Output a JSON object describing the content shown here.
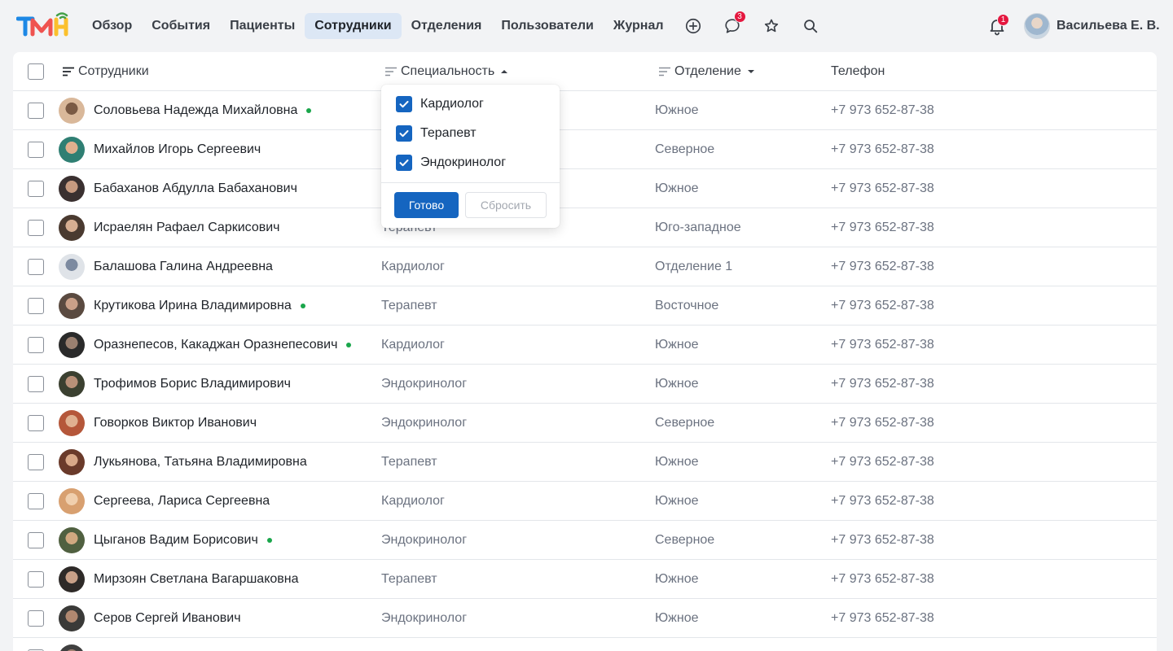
{
  "nav": {
    "items": [
      {
        "label": "Обзор",
        "active": false
      },
      {
        "label": "События",
        "active": false
      },
      {
        "label": "Пациенты",
        "active": false
      },
      {
        "label": "Сотрудники",
        "active": true
      },
      {
        "label": "Отделения",
        "active": false
      },
      {
        "label": "Пользователи",
        "active": false
      },
      {
        "label": "Журнал",
        "active": false
      }
    ],
    "icons": [
      "plus-circle-icon",
      "chat-icon",
      "star-icon",
      "search-icon"
    ],
    "chat_badge": "3",
    "notifications_badge": "1",
    "user_name": "Васильева Е. В."
  },
  "table": {
    "headers": {
      "name": "Сотрудники",
      "specialty": "Специальность",
      "department": "Отделение",
      "phone": "Телефон"
    },
    "rows": [
      {
        "name": "Соловьева Надежда Михайловна",
        "online": true,
        "specialty": "",
        "department": "Южное",
        "phone": "+7 973 652-87-38"
      },
      {
        "name": "Михайлов Игорь Сергеевич",
        "online": false,
        "specialty": "",
        "department": "Северное",
        "phone": "+7 973 652-87-38"
      },
      {
        "name": "Бабаханов Абдулла Бабаханович",
        "online": false,
        "specialty": "",
        "department": "Южное",
        "phone": "+7 973 652-87-38"
      },
      {
        "name": "Исраелян Рафаел Саркисович",
        "online": false,
        "specialty": "Терапевт",
        "department": "Юго-западное",
        "phone": "+7 973 652-87-38"
      },
      {
        "name": "Балашова Галина Андреевна",
        "online": false,
        "specialty": "Кардиолог",
        "department": "Отделение 1",
        "phone": "+7 973 652-87-38"
      },
      {
        "name": "Крутикова Ирина Владимировна",
        "online": true,
        "specialty": "Терапевт",
        "department": "Восточное",
        "phone": "+7 973 652-87-38"
      },
      {
        "name": "Оразнепесов, Какаджан Оразнепесович",
        "online": true,
        "specialty": "Кардиолог",
        "department": "Южное",
        "phone": "+7 973 652-87-38"
      },
      {
        "name": "Трофимов Борис Владимирович",
        "online": false,
        "specialty": "Эндокринолог",
        "department": "Южное",
        "phone": "+7 973 652-87-38"
      },
      {
        "name": "Говорков Виктор Иванович",
        "online": false,
        "specialty": "Эндокринолог",
        "department": "Северное",
        "phone": "+7 973 652-87-38"
      },
      {
        "name": "Лукьянова, Татьяна Владимировна",
        "online": false,
        "specialty": "Терапевт",
        "department": "Южное",
        "phone": "+7 973 652-87-38"
      },
      {
        "name": "Сергеева, Лариса Сергеевна",
        "online": false,
        "specialty": "Кардиолог",
        "department": "Южное",
        "phone": "+7 973 652-87-38"
      },
      {
        "name": "Цыганов Вадим Борисович",
        "online": true,
        "specialty": "Эндокринолог",
        "department": "Северное",
        "phone": "+7 973 652-87-38"
      },
      {
        "name": "Мирзоян Светлана Вагаршаковна",
        "online": false,
        "specialty": "Терапевт",
        "department": "Южное",
        "phone": "+7 973 652-87-38"
      },
      {
        "name": "Серов Сергей Иванович",
        "online": false,
        "specialty": "Эндокринолог",
        "department": "Южное",
        "phone": "+7 973 652-87-38"
      },
      {
        "name": "",
        "online": false,
        "specialty": "",
        "department": "",
        "phone": ""
      }
    ]
  },
  "filter_dropdown": {
    "options": [
      {
        "label": "Кардиолог",
        "checked": true
      },
      {
        "label": "Терапевт",
        "checked": true
      },
      {
        "label": "Эндокринолог",
        "checked": true
      }
    ],
    "apply_label": "Готово",
    "reset_label": "Сбросить"
  },
  "colors": {
    "accent": "#1565c0",
    "active_nav_bg": "#dce7f5",
    "online": "#1aa64b",
    "badge": "#e5173f"
  }
}
